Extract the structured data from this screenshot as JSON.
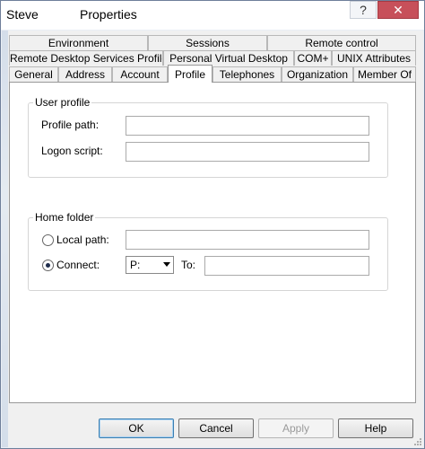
{
  "window": {
    "user_name": "Steve",
    "title": "Properties",
    "help_glyph": "?",
    "close_glyph": "✕"
  },
  "tabs": {
    "row1": [
      "Environment",
      "Sessions",
      "Remote control"
    ],
    "row2": [
      "Remote Desktop Services Profile",
      "Personal Virtual Desktop",
      "COM+",
      "UNIX Attributes"
    ],
    "row3": [
      "General",
      "Address",
      "Account",
      "Profile",
      "Telephones",
      "Organization",
      "Member Of"
    ],
    "active": "Profile"
  },
  "user_profile": {
    "title": "User profile",
    "profile_path_label": "Profile path:",
    "profile_path_value": "",
    "logon_script_label": "Logon script:",
    "logon_script_value": ""
  },
  "home_folder": {
    "title": "Home folder",
    "local_path_label": "Local path:",
    "local_path_value": "",
    "connect_label": "Connect:",
    "drive_value": "P:",
    "to_label": "To:",
    "to_value": "",
    "selected_option": "Connect"
  },
  "buttons": {
    "ok": "OK",
    "cancel": "Cancel",
    "apply": "Apply",
    "help": "Help"
  }
}
